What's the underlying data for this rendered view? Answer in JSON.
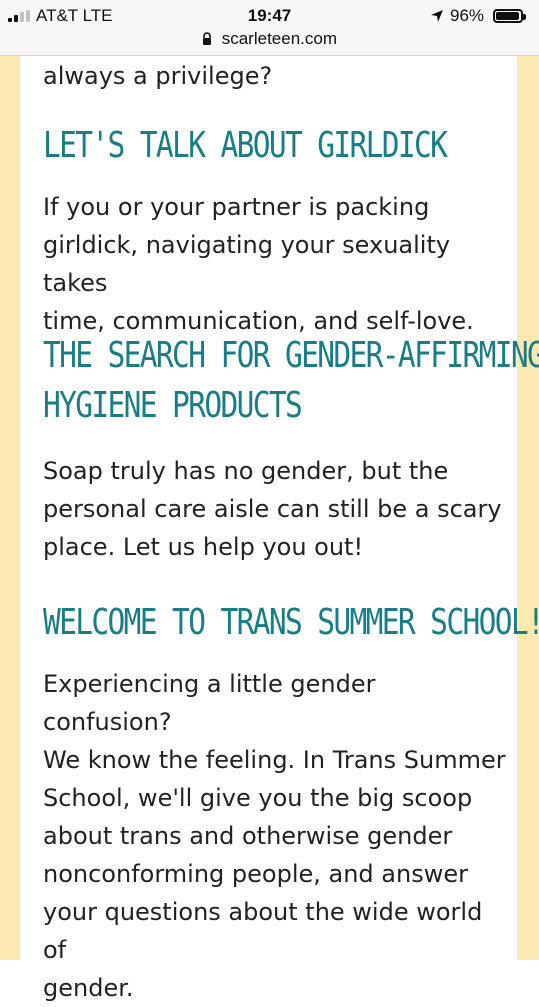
{
  "status_bar": {
    "carrier": "AT&T  LTE",
    "time": "19:47",
    "battery": "96%",
    "battery_fraction": 0.96,
    "url": "scarleteen.com"
  },
  "content": {
    "intro_tail": "always a privilege?",
    "sections": [
      {
        "title": "Let's Talk About Girldick",
        "summary_lines": [
          "If you or your partner is packing",
          "girldick, navigating your sexuality takes",
          "time, communication, and self-love."
        ]
      },
      {
        "title_lines": [
          "The Search for Gender-Affirming",
          "Hygiene Products"
        ],
        "summary_lines": [
          "Soap truly has no gender, but the",
          "personal care aisle can still be a scary",
          "place. Let us help you out!"
        ]
      },
      {
        "title": "Welcome to Trans Summer School!",
        "summary_lines": [
          "Experiencing a little gender confusion?",
          "We know the feeling. In Trans Summer",
          "School, we'll give you the big scoop",
          "about trans and otherwise gender",
          "nonconforming people, and answer",
          "your questions about the wide world of",
          "gender."
        ]
      }
    ]
  },
  "colors": {
    "title": "#1a7c84",
    "side_margin": "#fbeab0",
    "content_bg": "#ffffff",
    "text": "#222222"
  }
}
